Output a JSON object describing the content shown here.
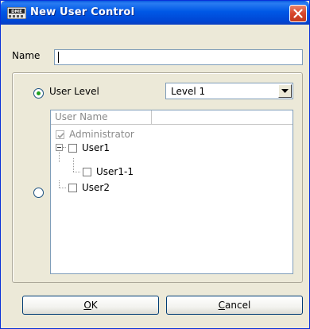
{
  "window": {
    "title": "New User Control",
    "icon": "dme-app-icon",
    "icon_text": "DME"
  },
  "name_field": {
    "label": "Name",
    "value": ""
  },
  "user_level": {
    "radio_label": "User Level",
    "selected": true,
    "dropdown_value": "Level 1"
  },
  "user_tree": {
    "radio_selected": false,
    "column_header": "User Name",
    "rows": [
      {
        "label": "Administrator",
        "checked": true,
        "disabled": true,
        "depth": 0
      },
      {
        "label": "User1",
        "checked": false,
        "disabled": false,
        "depth": 0,
        "expander": "collapse"
      },
      {
        "label": "User1-1",
        "checked": false,
        "disabled": false,
        "depth": 1
      },
      {
        "label": "User2",
        "checked": false,
        "disabled": false,
        "depth": 0
      }
    ]
  },
  "buttons": {
    "ok": {
      "mnemonic": "O",
      "rest": "K"
    },
    "cancel": {
      "mnemonic": "C",
      "rest": "ancel"
    }
  },
  "colors": {
    "titlebar": "#0058e6",
    "close_button": "#d8462b",
    "radio_dot": "#21a121",
    "window_bg": "#ece9d8"
  }
}
